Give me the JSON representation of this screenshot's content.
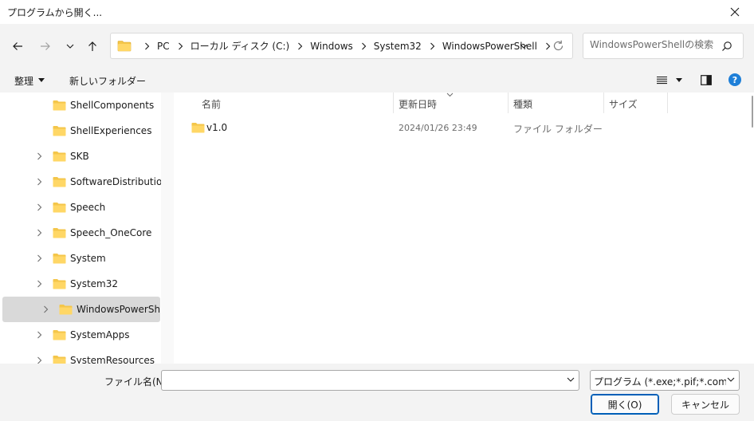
{
  "window": {
    "title": "プログラムから開く..."
  },
  "address": {
    "crumbs": [
      "PC",
      "ローカル ディスク (C:)",
      "Windows",
      "System32",
      "WindowsPowerShell"
    ]
  },
  "search": {
    "placeholder": "WindowsPowerShellの検索"
  },
  "commandbar": {
    "organize": "整理",
    "new_folder": "新しいフォルダー"
  },
  "tree": {
    "items": [
      {
        "label": "ShellComponents"
      },
      {
        "label": "ShellExperiences"
      },
      {
        "label": "SKB"
      },
      {
        "label": "SoftwareDistribution"
      },
      {
        "label": "Speech"
      },
      {
        "label": "Speech_OneCore"
      },
      {
        "label": "System"
      },
      {
        "label": "System32"
      },
      {
        "label": "WindowsPowerShell"
      },
      {
        "label": "SystemApps"
      },
      {
        "label": "SystemResources"
      }
    ]
  },
  "columns": {
    "name": "名前",
    "modified": "更新日時",
    "type": "種類",
    "size": "サイズ"
  },
  "files": [
    {
      "name": "v1.0",
      "modified": "2024/01/26 23:49",
      "type": "ファイル フォルダー",
      "size": ""
    }
  ],
  "bottom": {
    "filename_label": "ファイル名(N):",
    "filename_value": "",
    "filter": "プログラム (*.exe;*.pif;*.com;*.bat",
    "open_label": "開く(O)",
    "cancel_label": "キャンセル"
  },
  "colors": {
    "folder": "#f4c64a",
    "accent": "#005fb8",
    "help": "#1e7fd8",
    "selected": "#d9d9d9"
  }
}
